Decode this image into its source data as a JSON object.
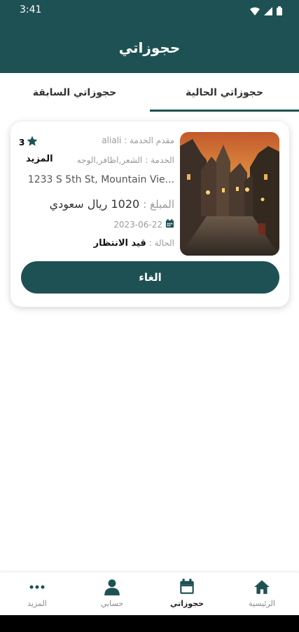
{
  "status_bar": {
    "time": "3:41",
    "icons": [
      "wifi-icon",
      "signal-icon",
      "battery-icon"
    ]
  },
  "header": {
    "title": "حجوزاتي"
  },
  "tabs": {
    "current": "حجوزاتي الحالية",
    "previous": "حجوزاتي السابقة",
    "active": "current"
  },
  "booking": {
    "provider_label": "مقدم الخدمة :",
    "provider_value": "aliali",
    "service_label": "الخدمة :",
    "service_value": "الشعر,اظافر,الوجه",
    "address": "1233 S 5th St, Mountain Vie...",
    "amount_label": "المبلغ :",
    "amount_value": "1020 ريال سعودي",
    "date": "2023-06-22",
    "status_label": "الحالة :",
    "status_value": "قيد الانتظار",
    "rating": "3",
    "more_label": "المزيد",
    "cancel_label": "الغاء"
  },
  "bottom_nav": {
    "items": [
      {
        "label": "الرئيسية",
        "icon": "home-icon"
      },
      {
        "label": "حجوزاتي",
        "icon": "calendar-icon"
      },
      {
        "label": "حسابي",
        "icon": "person-icon"
      },
      {
        "label": "المزيد",
        "icon": "more-dots-icon"
      }
    ],
    "active": "حجوزاتي"
  },
  "colors": {
    "primary": "#1e5153",
    "star": "#1e5153"
  }
}
